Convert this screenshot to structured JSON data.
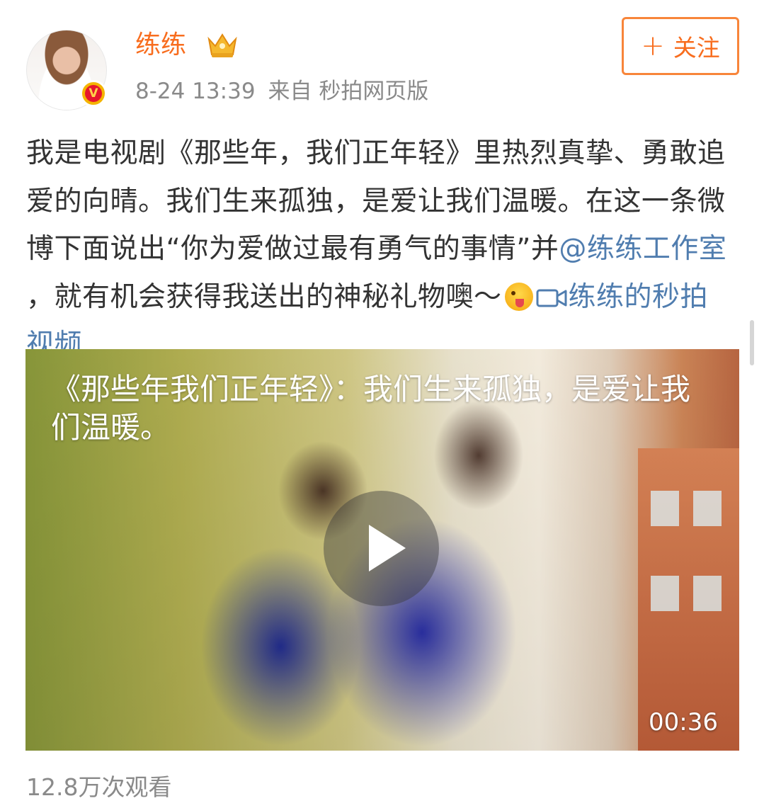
{
  "author": {
    "name": "练练",
    "avatar_icon": "avatar-photo",
    "verified_icon": "verified-v-icon",
    "verified_letter": "V",
    "member_icon": "vip-crown-icon"
  },
  "post_meta": {
    "time": "8-24 13:39",
    "source": "来自 秒拍网页版"
  },
  "follow_button": {
    "icon": "plus-icon",
    "label": "关注"
  },
  "post": {
    "text_intro": "我是电视剧《那些年，我们正年轻》里热烈真挚、勇敢追爱的向晴。我们生来孤独，是爱让我们温暖。在这一条微博下面说出“你为爱做过最有勇气的事情”并",
    "mention": "@练练工作室",
    "text_after_mention": " ，就有机会获得我送出的神秘礼物噢～",
    "emoji_icon": "tongue-wink-emoji",
    "video_link_icon": "video-camera-icon",
    "video_link": "练练的秒拍视频"
  },
  "video": {
    "caption": "《那些年我们正年轻》：我们生来孤独，是爱让我们温暖。",
    "play_icon": "play-icon",
    "duration": "00:36"
  },
  "stats": {
    "views": "12.8万次观看"
  },
  "colors": {
    "accent_orange": "#f86d1e",
    "link_blue": "#507daf",
    "text": "#333333",
    "meta_gray": "#8a8a8a"
  }
}
